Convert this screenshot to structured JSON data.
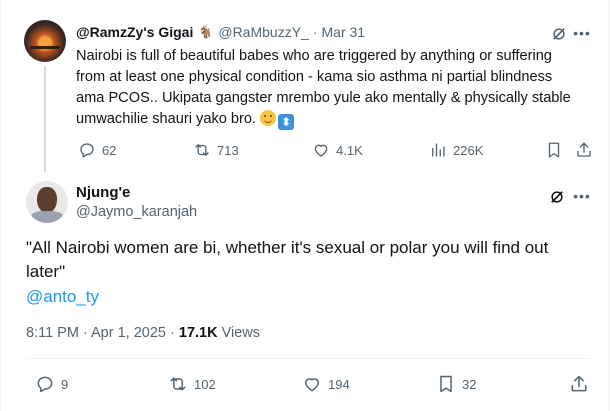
{
  "parent_tweet": {
    "display_name": "@RamzZy's Gigai",
    "handle": "@RaMbuzzY_",
    "separator": "·",
    "date": "Mar 31",
    "text": "Nairobi is full of beautiful babes who are triggered by anything or suffering from at least one physical condition - kama sio asthma ni partial blindness ama PCOS.. Ukipata gangster mrembo yule ako mentally & physically stable umwachilie shauri yako bro.",
    "stats": {
      "replies": "62",
      "reposts": "713",
      "likes": "4.1K",
      "views": "226K"
    }
  },
  "main_tweet": {
    "display_name": "Njung'e",
    "handle": "@Jaymo_karanjah",
    "text": "\"All Nairobi women are bi, whether it's sexual or polar you will find out later\"",
    "mention": "@anto_ty",
    "time": "8:11 PM · Apr 1, 2025 · ",
    "views_count": "17.1K",
    "views_label": " Views",
    "stats": {
      "replies": "9",
      "reposts": "102",
      "likes": "194",
      "bookmarks": "32"
    }
  },
  "colors": {
    "text": "#0f1419",
    "secondary": "#536471",
    "link": "#1d9bf0",
    "border": "#eff3f4",
    "thread_line": "#cfd9de"
  },
  "icons": [
    "grok-icon",
    "more-icon",
    "reply-icon",
    "repost-icon",
    "like-icon",
    "views-icon",
    "bookmark-icon",
    "share-icon"
  ]
}
